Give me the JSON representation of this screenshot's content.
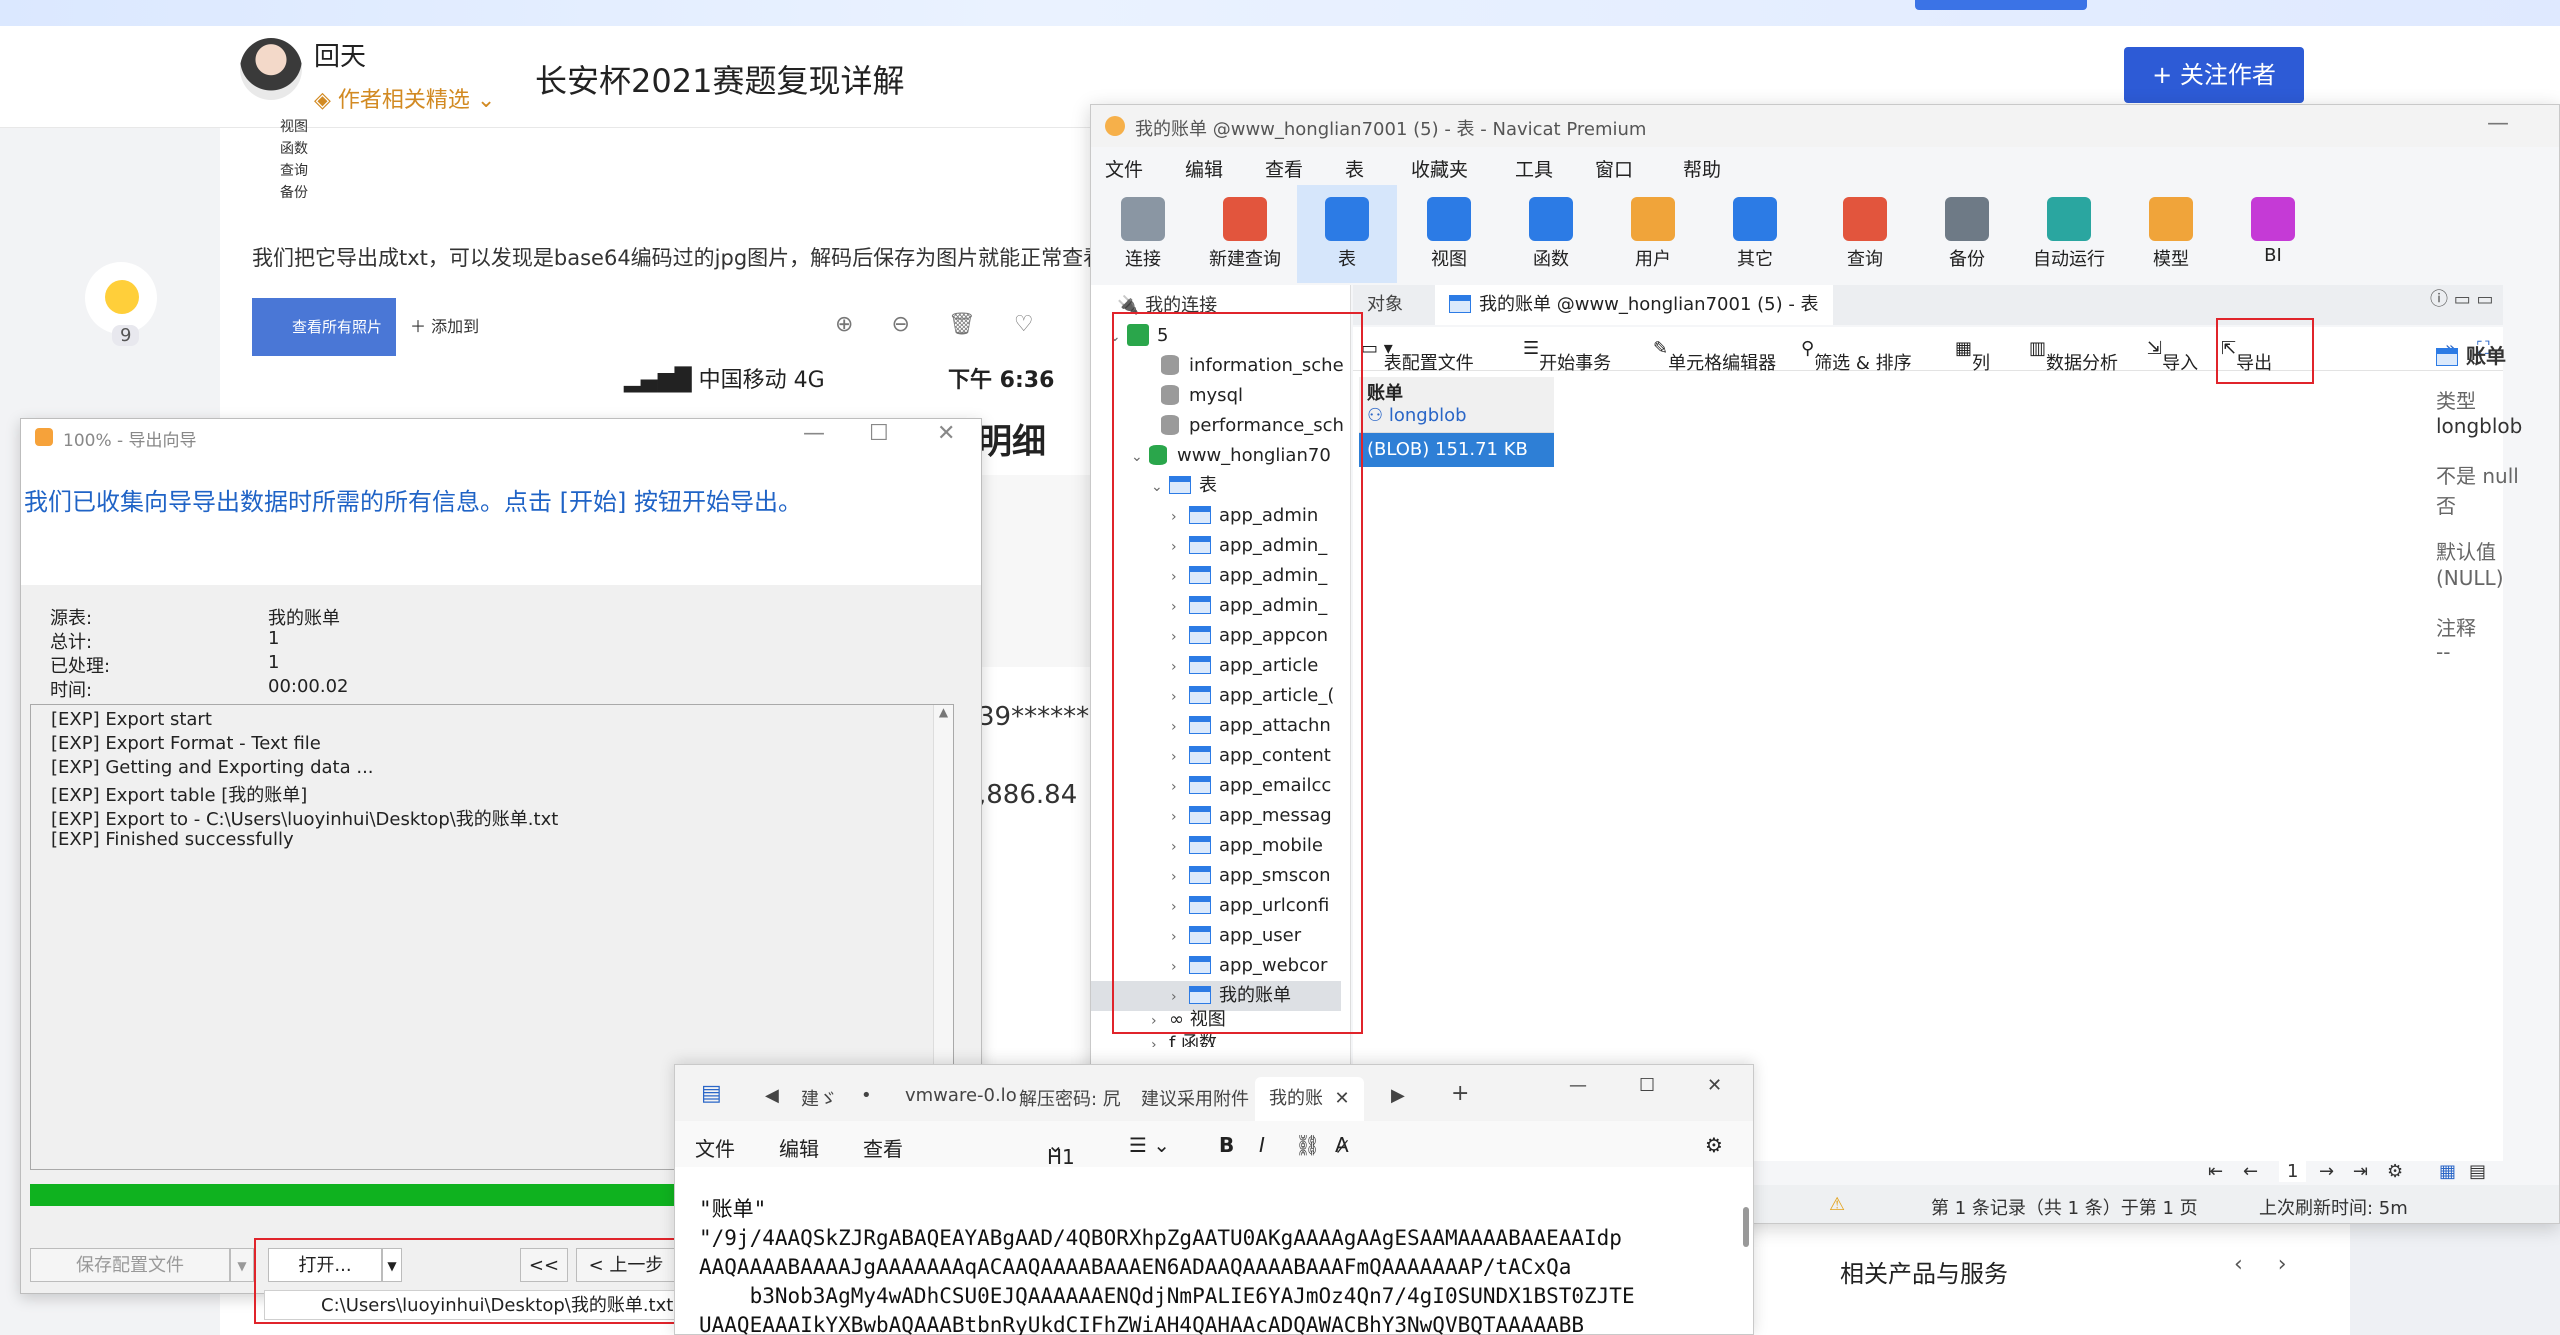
{
  "page": {
    "author_name": "回天",
    "author_badge": "作者相关精选",
    "article_title": "长安杯2021赛题复现详解",
    "follow_label": "+ 关注作者",
    "like_count": "9",
    "article_text": "我们把它导出成txt，可以发现是base64编码过的jpg图片，解码后保存为图片就能正常查看，",
    "mini_tree": [
      "视图",
      "函数",
      "查询",
      "备份"
    ],
    "gallery_button": "查看所有照片",
    "gallery_add": "添加到",
    "phone_carrier": "中国移动  4G",
    "phone_time": "下午 6:36",
    "peek_title": "明细",
    "peek_card": "39****** 6",
    "peek_amount": ",886.84",
    "right_panel_title": "相关产品与服务",
    "right_panel_arrows": "‹ ›"
  },
  "navicat": {
    "title": "我的账单 @www_honglian7001 (5) - 表 - Navicat Premium",
    "menu": [
      "文件",
      "编辑",
      "查看",
      "表",
      "收藏夹",
      "工具",
      "窗口",
      "帮助"
    ],
    "toolbar": [
      "连接",
      "新建查询",
      "表",
      "视图",
      "函数",
      "用户",
      "其它",
      "查询",
      "备份",
      "自动运行",
      "模型",
      "BI"
    ],
    "toolbar_icon_colors": [
      "#8a96a3",
      "#e2553d",
      "#2c7be5",
      "#2c7be5",
      "#2c7be5",
      "#f0a43a",
      "#2c7be5",
      "#e2553d",
      "#6e7a86",
      "#2aa6a0",
      "#f0a43a",
      "#c53ad6"
    ],
    "tree_header": "我的连接",
    "tree": {
      "conn": "5",
      "dbs": [
        "information_sche",
        "mysql",
        "performance_sch",
        "www_honglian70"
      ],
      "tables_label": "表",
      "tables": [
        "app_admin",
        "app_admin_",
        "app_admin_",
        "app_admin_",
        "app_appcon",
        "app_article",
        "app_article_(",
        "app_attachn",
        "app_content",
        "app_emailcc",
        "app_messag",
        "app_mobile",
        "app_smscon",
        "app_urlconfi",
        "app_user",
        "app_webcor",
        "我的账单"
      ],
      "views_label": "视图",
      "funcs_label": "函数"
    },
    "tabs": [
      "对象",
      "我的账单 @www_honglian7001 (5) - 表"
    ],
    "subtoolbar": [
      "表配置文件",
      "开始事务",
      "单元格编辑器",
      "筛选 & 排序",
      "列",
      "数据分析",
      "导入",
      "导出"
    ],
    "grid": {
      "column": "账单",
      "column_type": "longblob",
      "cell": "(BLOB) 151.71 KB"
    },
    "field_props": {
      "name": "账单",
      "type_label": "类型",
      "type_value": "longblob",
      "null_label": "不是 null",
      "null_value": "否",
      "default_label": "默认值",
      "default_value": "(NULL)",
      "comment_label": "注释",
      "comment_value": "--"
    },
    "pager_value": "1",
    "status": {
      "record": "第 1 条记录（共 1 条）于第 1 页",
      "refresh": "上次刷新时间: 5m"
    }
  },
  "wizard": {
    "title": "100% - 导出向导",
    "heading": "我们已收集向导导出数据时所需的所有信息。点击 [开始] 按钮开始导出。",
    "rows": [
      {
        "k": "源表:",
        "v": "我的账单"
      },
      {
        "k": "总计:",
        "v": "1"
      },
      {
        "k": "已处理:",
        "v": "1"
      },
      {
        "k": "时间:",
        "v": "00:00.02"
      }
    ],
    "log": [
      "[EXP] Export start",
      "[EXP] Export Format - Text file",
      "[EXP] Getting and Exporting data ...",
      "[EXP] Export table [我的账单]",
      "[EXP] Export to - C:\\Users\\luoyinhui\\Desktop\\我的账单.txt",
      "[EXP] Finished successfully"
    ],
    "progress": 1.0,
    "save_profile": "保存配置文件",
    "open": "打开...",
    "first": "<<",
    "prev": "< 上一步",
    "dropdown_path": "C:\\Users\\luoyinhui\\Desktop\\我的账单.txt"
  },
  "notepad": {
    "tabs": [
      "建ゞ",
      "vmware-0.lo",
      "解压密码: 凥",
      "建议采用附件",
      "我的账"
    ],
    "menu": [
      "文件",
      "编辑",
      "查看"
    ],
    "heading_select": "H1",
    "lines": [
      "\"账单\"",
      "\"/9j/4AAQSkZJRgABAQEAYABgAAD/4QBORXhpZgAATU0AKgAAAAgAAgESAAMAAAABAAEAAIdp",
      "AAQAAAABAAAAJgAAAAAAAqACAAQAAAABAAAEN6ADAAQAAAABAAAFmQAAAAAAAP/tACxQa",
      "    b3Nob3AgMy4wADhCSU0EJQAAAAAAENQdjNmPALIE6YAJmOz4Qn7/4gI0SUNDX1BST0ZJTE",
      "UAAQEAAAIkYXBwbAQAAABtbnRyUkdCIFhZWiAH4QAHAAcADQAWACBhY3NwQVBQTAAAAABB"
    ]
  }
}
